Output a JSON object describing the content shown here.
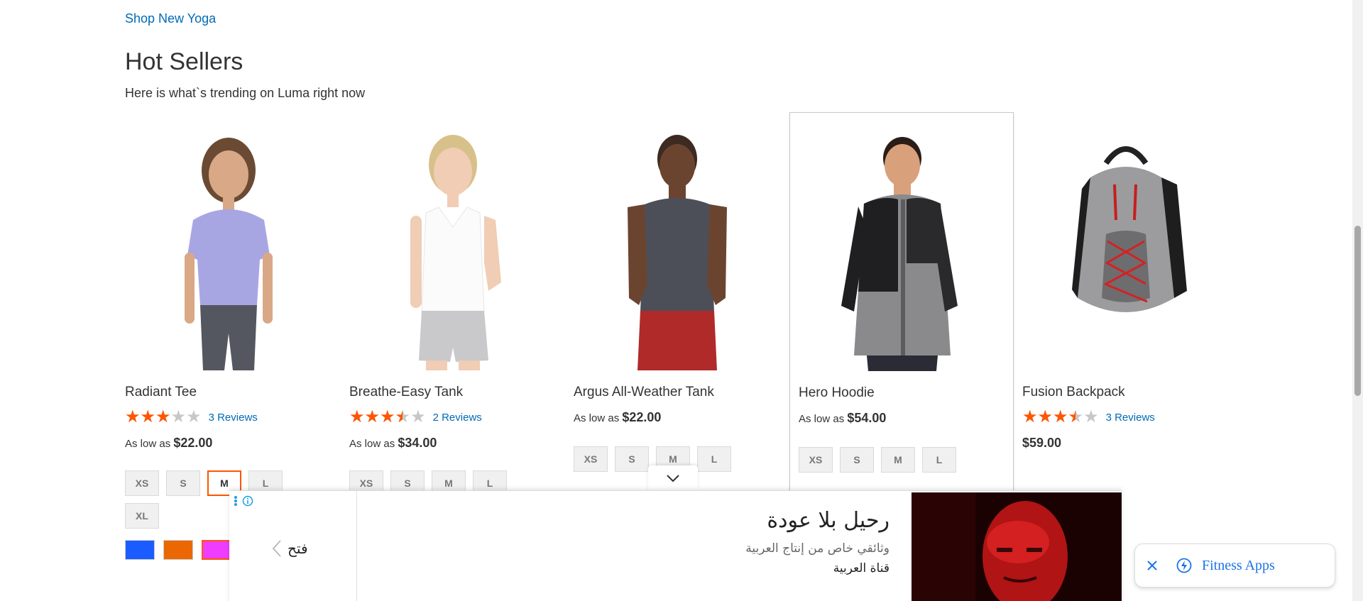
{
  "top_link": "Shop New Yoga",
  "section": {
    "title": "Hot Sellers",
    "subtitle": "Here is what`s trending on Luma right now"
  },
  "products": [
    {
      "name": "Radiant Tee",
      "rating": 3,
      "reviews": "3 Reviews",
      "price_prefix": "As low as",
      "price": "$22.00",
      "sizes": [
        "XS",
        "S",
        "M",
        "L",
        "XL"
      ],
      "selected_size": "M",
      "colors": [
        "#1a5cff",
        "#eb6703",
        "#ef3dff"
      ],
      "selected_color": "#ef3dff"
    },
    {
      "name": "Breathe-Easy Tank",
      "rating": 3.5,
      "reviews": "2 Reviews",
      "price_prefix": "As low as",
      "price": "$34.00",
      "sizes": [
        "XS",
        "S",
        "M",
        "L"
      ]
    },
    {
      "name": "Argus All-Weather Tank",
      "price_prefix": "As low as",
      "price": "$22.00",
      "sizes": [
        "XS",
        "S",
        "M",
        "L"
      ]
    },
    {
      "name": "Hero Hoodie",
      "price_prefix": "As low as",
      "price": "$54.00",
      "sizes": [
        "XS",
        "S",
        "M",
        "L"
      ]
    },
    {
      "name": "Fusion Backpack",
      "rating": 3.5,
      "reviews": "3 Reviews",
      "price": "$59.00"
    }
  ],
  "ad": {
    "open_label": "فتح",
    "headline": "رحيل بلا عودة",
    "description": "وثائقي خاص من إنتاج العربية",
    "source": "قناة العربية"
  },
  "fitness_chip": {
    "label": "Fitness Apps"
  },
  "colors": {
    "link": "#006bb4",
    "star": "#ff5501",
    "selected": "#ff5501"
  }
}
